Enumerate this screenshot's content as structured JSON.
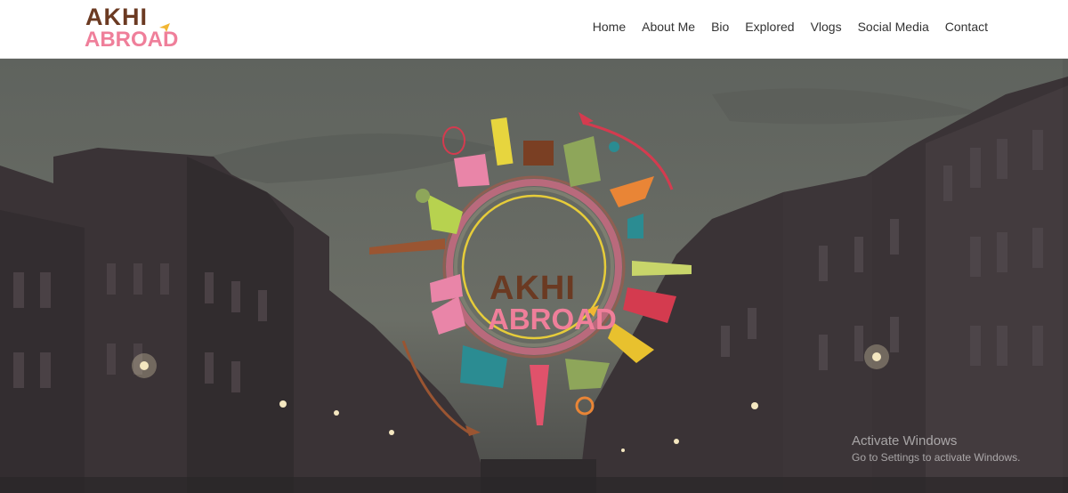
{
  "brand": {
    "line1": "AKHI",
    "line2": "ABROAD"
  },
  "nav": {
    "items": [
      "Home",
      "About Me",
      "Bio",
      "Explored",
      "Vlogs",
      "Social Media",
      "Contact"
    ]
  },
  "hero": {
    "emblem_line1": "AKHI",
    "emblem_line2": "ABROAD"
  },
  "watermark": {
    "title": "Activate Windows",
    "subtitle": "Go to Settings to activate Windows."
  },
  "colors": {
    "brand_brown": "#6b3a22",
    "brand_pink": "#ef7f9a",
    "hero_overlay": "#4f534e"
  }
}
